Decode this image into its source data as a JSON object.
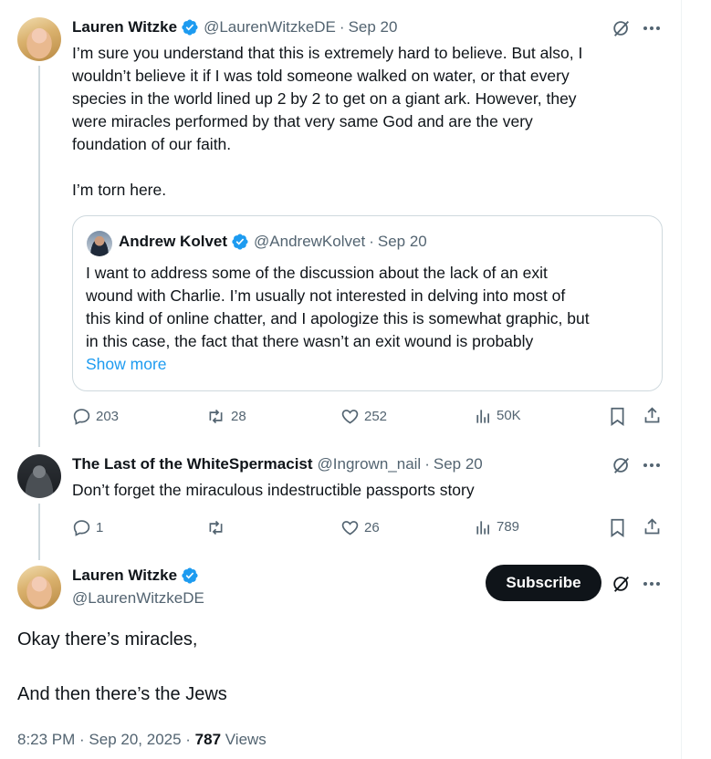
{
  "colors": {
    "accent": "#1d9bf0",
    "text": "#0f1419",
    "muted": "#536471",
    "border": "#cfd9de",
    "verified": "#1d9bf0"
  },
  "tweet1": {
    "name": "Lauren Witzke",
    "handle": "@LaurenWitzkeDE",
    "separator": "·",
    "time": "Sep 20",
    "lines": [
      "I’m sure you understand that this is extremely hard to believe. But also, I",
      "wouldn’t believe it if I was told someone walked on water, or that every",
      "species in the world lined up 2 by 2 to get on a giant ark. However, they",
      "were miracles performed by that very same God and are the very",
      "foundation of our faith."
    ],
    "line6": "I’m torn here.",
    "quote": {
      "name": "Andrew Kolvet",
      "handle": "@AndrewKolvet",
      "separator": "·",
      "time": "Sep 20",
      "lines": [
        "I want to address some of the discussion about the lack of an exit",
        "wound with Charlie. I’m usually not interested in delving into most of",
        "this kind of online chatter, and I apologize this is somewhat graphic, but",
        "in this case, the fact that there wasn’t an exit wound is probably"
      ],
      "show_more": "Show more"
    },
    "actions": {
      "replies": "203",
      "reposts": "28",
      "likes": "252",
      "views": "50K"
    }
  },
  "tweet2": {
    "name": "The Last of the WhiteSpermacist",
    "handle": "@Ingrown_nail",
    "separator": "·",
    "time": "Sep 20",
    "text": "Don’t forget the miraculous indestructible passports story",
    "actions": {
      "replies": "1",
      "reposts": "",
      "likes": "26",
      "views": "789"
    }
  },
  "main": {
    "name": "Lauren Witzke",
    "handle": "@LaurenWitzkeDE",
    "subscribe_label": "Subscribe",
    "line1": "Okay there’s miracles,",
    "line2": "And then there’s the Jews",
    "timestamp": "8:23 PM · Sep 20, 2025 · ",
    "views_count": "787",
    "views_label": " Views"
  }
}
